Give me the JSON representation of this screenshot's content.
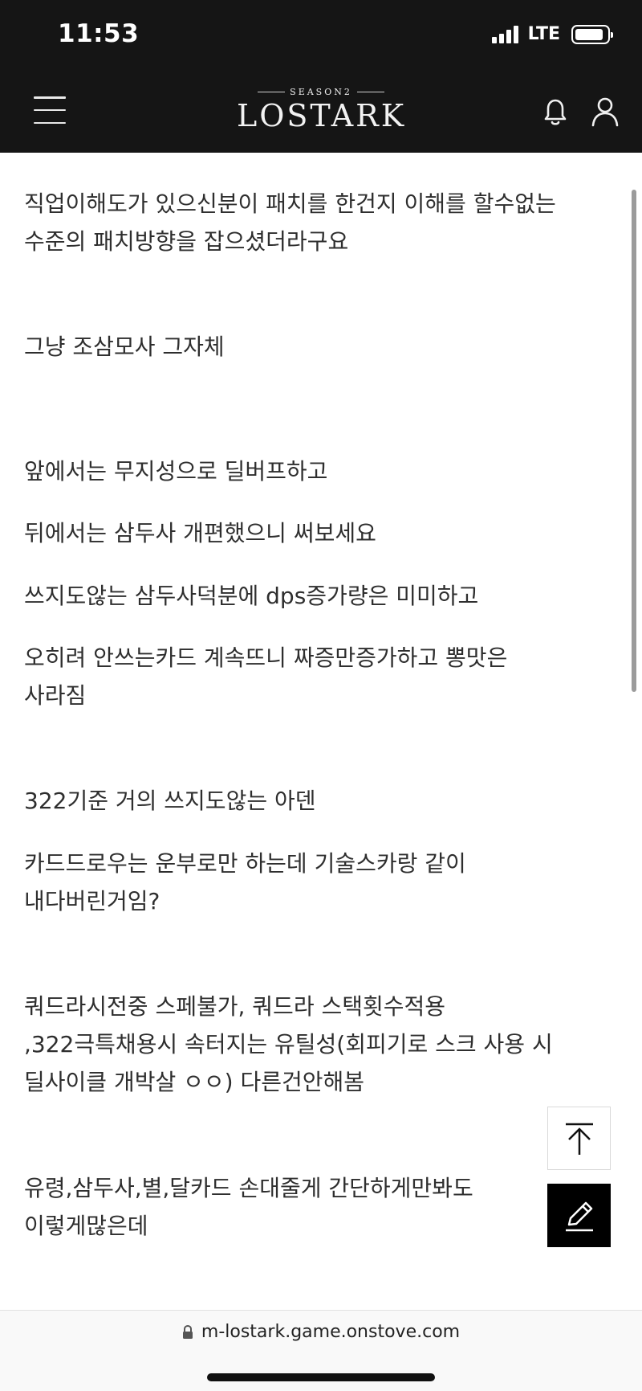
{
  "status_bar": {
    "time": "11:53",
    "network": "LTE",
    "battery_percent": 90,
    "signal_bars": 4
  },
  "header": {
    "logo_season": "SEASON2",
    "logo_text": "LOSTARK",
    "menu_icon": "hamburger-menu-icon",
    "notification_icon": "bell-icon",
    "profile_icon": "user-icon"
  },
  "post": {
    "paragraphs": [
      [
        "직업이해도가 있으신분이 패치를 한건지 이해를 할수없는",
        "수준의 패치방향을 잡으셨더라구요"
      ],
      [
        "그냥 조삼모사 그자체"
      ],
      [
        "앞에서는 무지성으로 딜버프하고"
      ],
      [
        "뒤에서는 삼두사 개편했으니 써보세요"
      ],
      [
        "쓰지도않는 삼두사덕분에 dps증가량은 미미하고"
      ],
      [
        "오히려 안쓰는카드 계속뜨니 짜증만증가하고 뽕맛은",
        "사라짐"
      ],
      [
        "322기준 거의 쓰지도않는 아덴"
      ],
      [
        "카드드로우는 운부로만 하는데 기술스카랑 같이",
        "내다버린거임?"
      ],
      [
        "쿼드라시전중 스페불가, 쿼드라 스택횟수적용",
        ",322극특채용시 속터지는 유틸성(회피기로 스크 사용 시",
        "딜사이클 개박살 ㅇㅇ) 다른건안해봄"
      ],
      [
        "유령,삼두사,별,달카드 손대줄게 간단하게만봐도",
        "이렇게많은데"
      ]
    ]
  },
  "floating": {
    "scroll_top_icon": "arrow-up-icon",
    "write_icon": "pencil-icon"
  },
  "browser": {
    "url": "m-lostark.game.onstove.com",
    "lock_icon": "lock-icon"
  }
}
